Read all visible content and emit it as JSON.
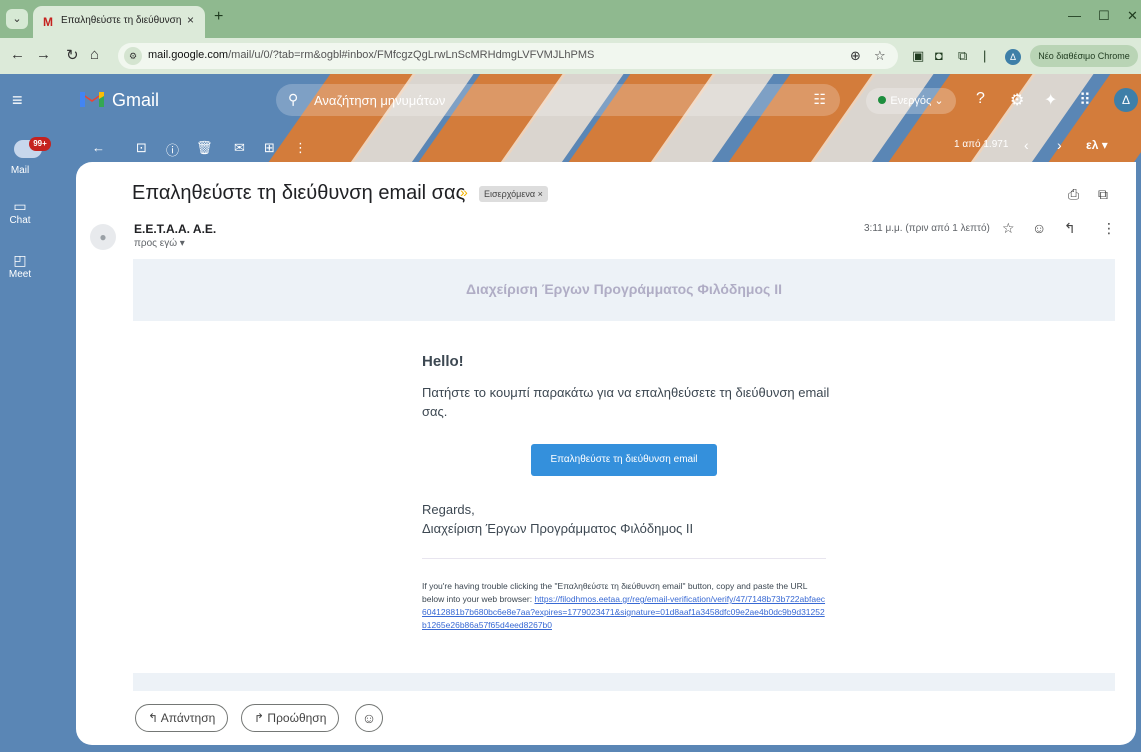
{
  "browser": {
    "tab_title": "Επαληθεύστε τη διεύθυνση em",
    "tab_close": "×",
    "new_tab": "+",
    "url_domain": "mail.google.com",
    "url_path": "/mail/u/0/?tab=rm&ogbl#inbox/FMfcgzQgLrwLnScMRHdmgLVFVMJLhPMS",
    "profile_initial": "Δ",
    "new_chrome_label": "Νέο διαθέσιμο Chrome"
  },
  "gmail": {
    "app_name": "Gmail",
    "search_placeholder": "Αναζήτηση μηνυμάτων",
    "status": "Ενεργός",
    "account_initial": "Δ",
    "rail": {
      "mail_badge": "99+",
      "mail_label": "Mail",
      "chat_label": "Chat",
      "meet_label": "Meet"
    },
    "toolbar": {
      "pager": "1 από 1.971",
      "lang": "ελ"
    },
    "message": {
      "subject": "Επαληθεύστε τη διεύθυνση email σας",
      "label": "Εισερχόμενα ×",
      "sender": "E.E.T.A.A. A.E.",
      "to": "προς εγώ ▾",
      "time": "3:11 μ.μ. (πριν από 1 λεπτό)"
    },
    "email": {
      "brand": "Διαχείριση Έργων Προγράμματος Φιλόδημος ΙΙ",
      "hello": "Hello!",
      "intro": "Πατήστε το κουμπί παρακάτω για να επαληθεύσετε τη διεύθυνση email σας.",
      "button": "Επαληθεύστε τη διεύθυνση email",
      "regards": "Regards,",
      "signature": "Διαχείριση Έργων Προγράμματος Φιλόδημος ΙΙ",
      "subcopy_text": "If you're having trouble clicking the \"Επαληθεύστε τη διεύθυνση email\" button, copy and paste the URL below into your web browser: ",
      "subcopy_link": "https://filodhmos.eetaa.gr/reg/email-verification/verify/47/7148b73b722abfaec60412881b7b680bc6e8e7aa?expires=1779023471&signature=01d8aaf1a3458dfc09e2ae4b0dc9b9d31252b1265e26b86a57f65d4eed8267b0"
    },
    "actions": {
      "reply": "Απάντηση",
      "forward": "Προώθηση"
    }
  }
}
